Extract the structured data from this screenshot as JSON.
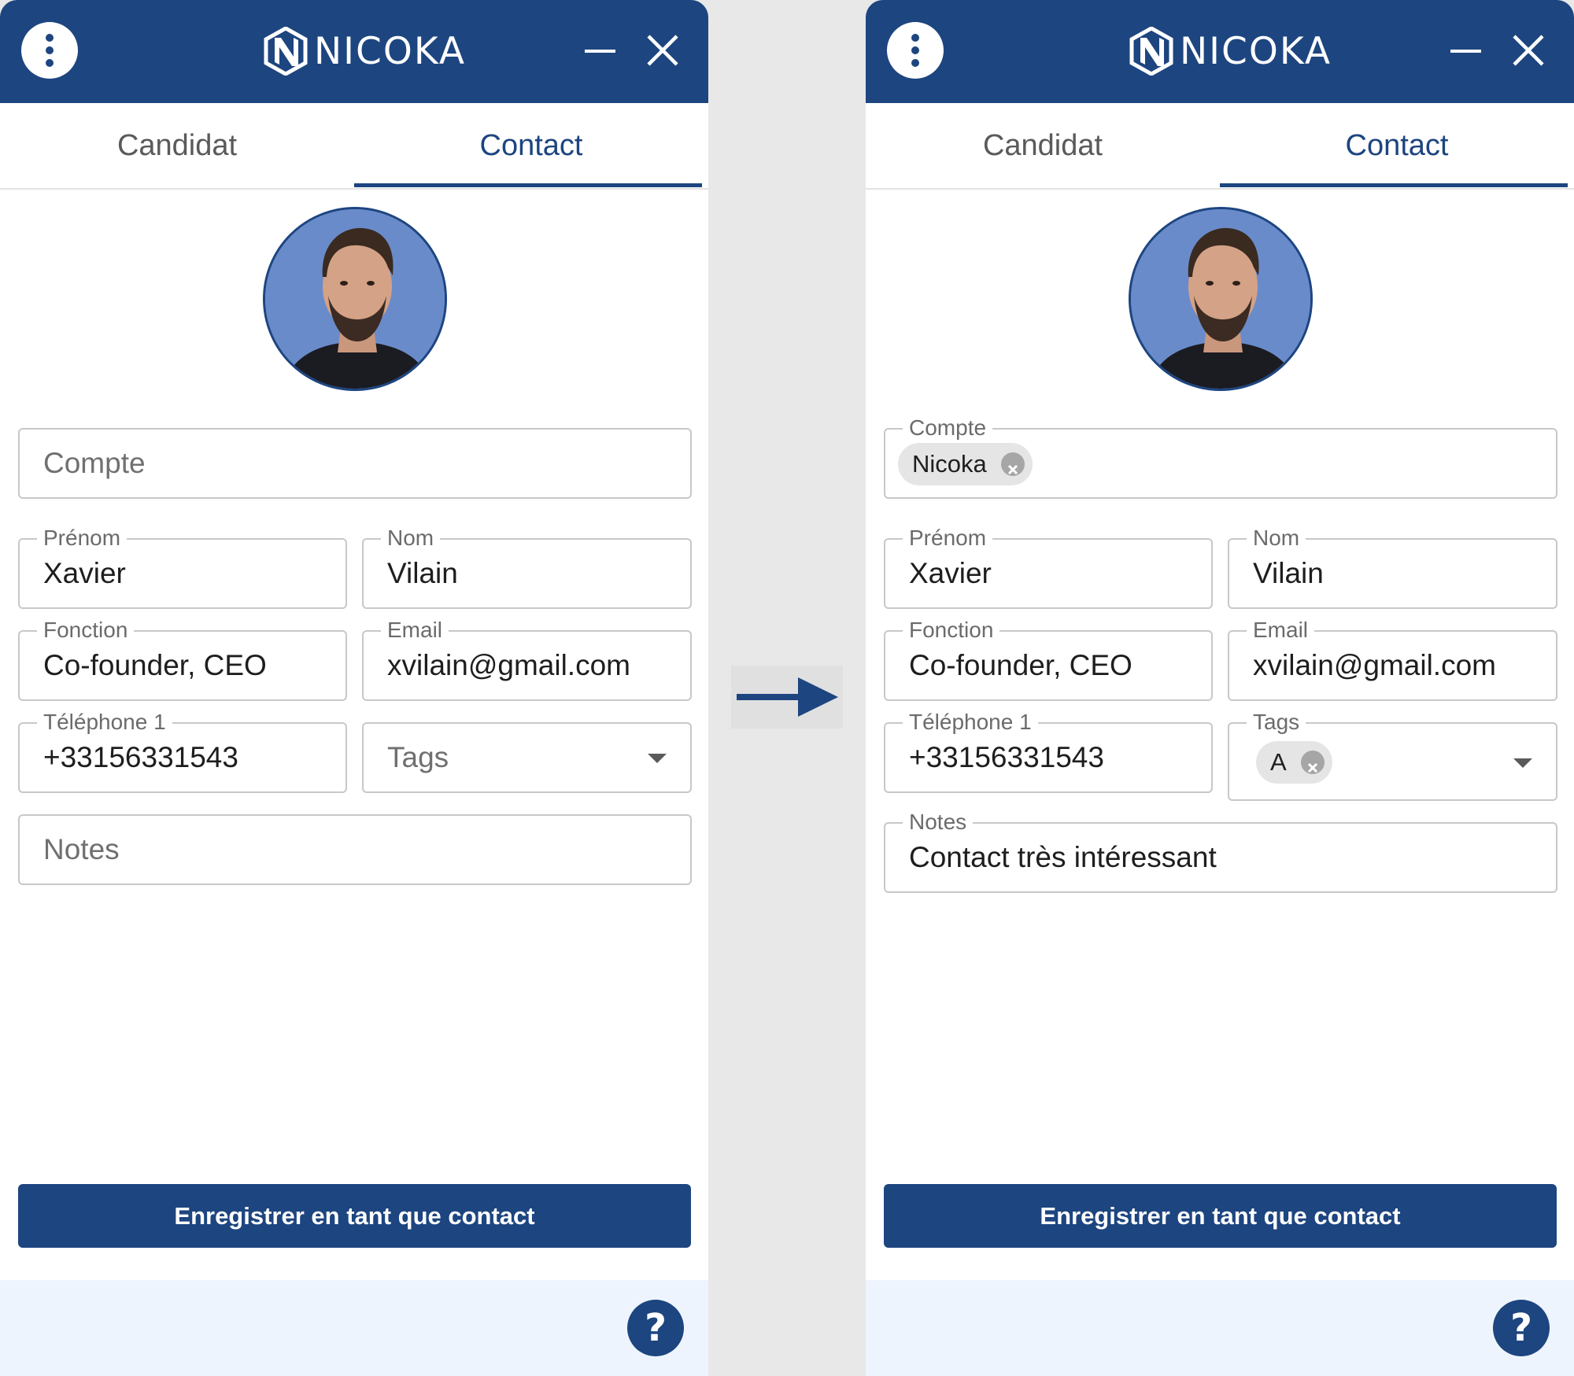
{
  "colors": {
    "brand": "#1d4580",
    "page_background": "#e8e8e8",
    "footer_background": "#eef4fd",
    "field_border": "#c8c8c8",
    "chip_background": "#e5e5e5"
  },
  "icons": {
    "menu": "vertical-dots-icon",
    "minimize": "minus-icon",
    "close": "close-x-icon",
    "help": "question-mark-icon",
    "chip_remove": "circle-x-icon",
    "dropdown": "caret-down-icon",
    "transition": "arrow-right-icon"
  },
  "before": {
    "header": {
      "brand": "NICOKA"
    },
    "tabs": [
      {
        "label": "Candidat",
        "active": false
      },
      {
        "label": "Contact",
        "active": true
      }
    ],
    "fields": {
      "compte": {
        "placeholder": "Compte"
      },
      "prenom": {
        "label": "Prénom",
        "value": "Xavier"
      },
      "nom": {
        "label": "Nom",
        "value": "Vilain"
      },
      "fonction": {
        "label": "Fonction",
        "value": "Co-founder, CEO"
      },
      "email": {
        "label": "Email",
        "value": "xvilain@gmail.com"
      },
      "telephone": {
        "label": "Téléphone 1",
        "value": "+33156331543"
      },
      "tags": {
        "placeholder": "Tags"
      },
      "notes": {
        "placeholder": "Notes"
      }
    },
    "submit_label": "Enregistrer en tant que contact",
    "help_label": "?"
  },
  "after": {
    "header": {
      "brand": "NICOKA"
    },
    "tabs": [
      {
        "label": "Candidat",
        "active": false
      },
      {
        "label": "Contact",
        "active": true
      }
    ],
    "fields": {
      "compte": {
        "label": "Compte",
        "chip": "Nicoka"
      },
      "prenom": {
        "label": "Prénom",
        "value": "Xavier"
      },
      "nom": {
        "label": "Nom",
        "value": "Vilain"
      },
      "fonction": {
        "label": "Fonction",
        "value": "Co-founder, CEO"
      },
      "email": {
        "label": "Email",
        "value": "xvilain@gmail.com"
      },
      "telephone": {
        "label": "Téléphone 1",
        "value": "+33156331543"
      },
      "tags": {
        "label": "Tags",
        "chip": "A"
      },
      "notes": {
        "label": "Notes",
        "value": "Contact très intéressant"
      }
    },
    "submit_label": "Enregistrer en tant que contact",
    "help_label": "?"
  }
}
